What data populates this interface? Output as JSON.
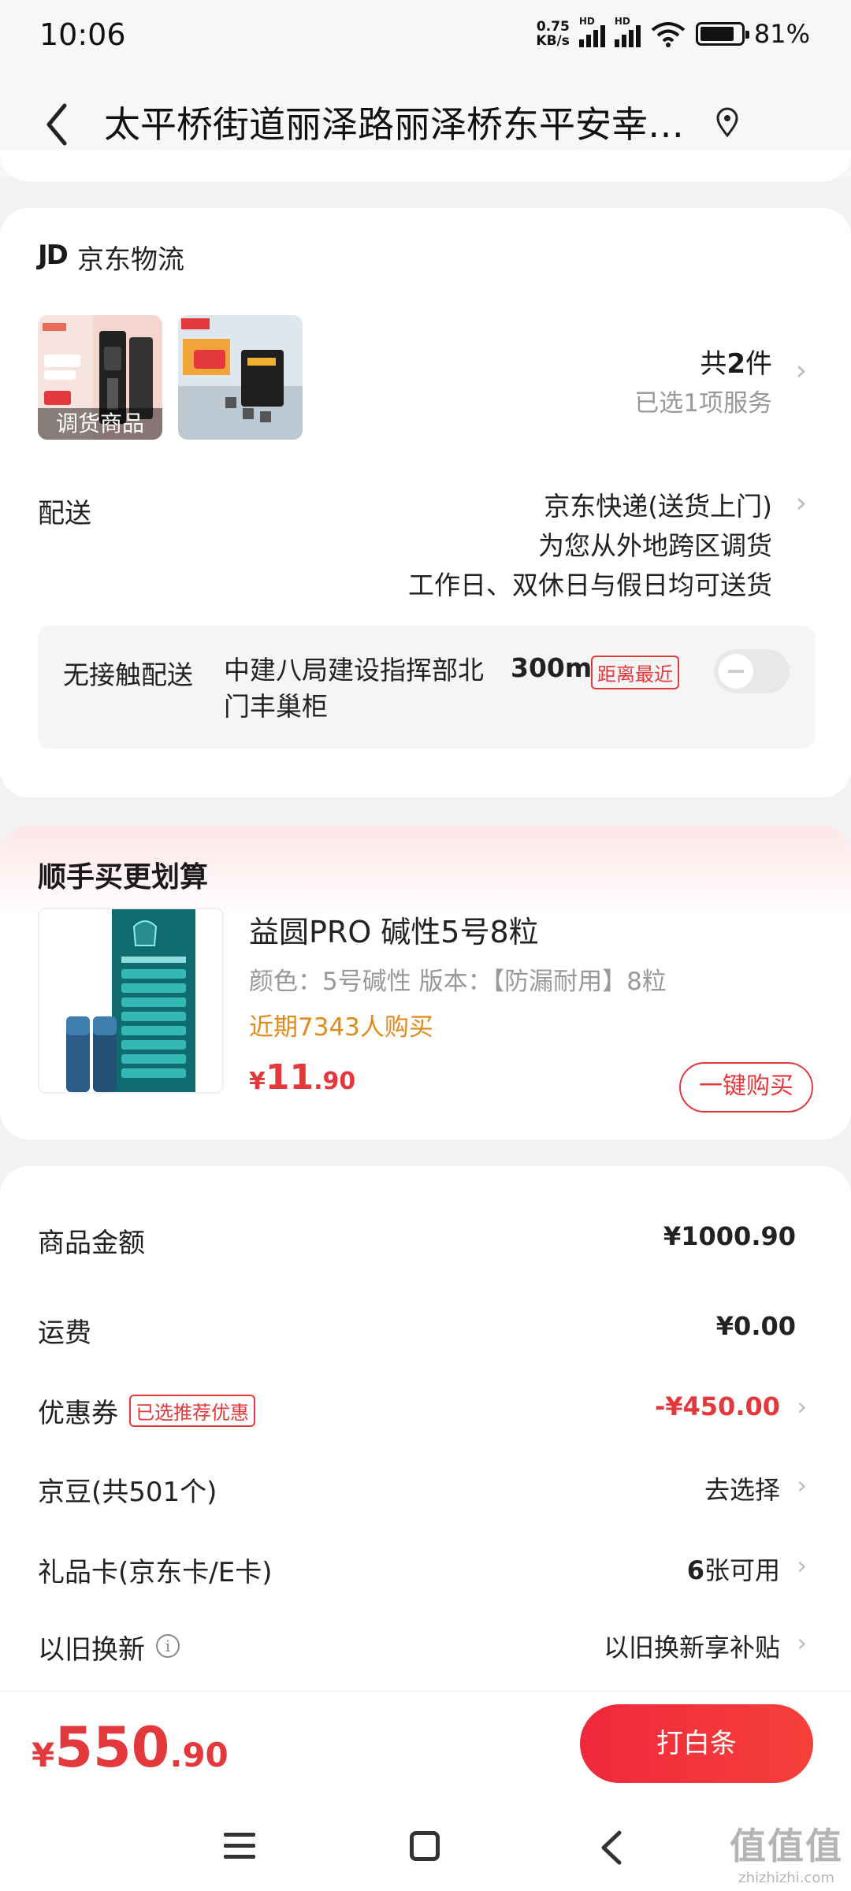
{
  "status_bar": {
    "time": "10:06",
    "speed_value": "0.75",
    "speed_unit": "KB/s",
    "battery": "81%"
  },
  "header": {
    "address": "太平桥街道丽泽路丽泽桥东平安幸…"
  },
  "logistics": {
    "brand_logo": "JD",
    "brand_label": "京东物流",
    "product_tag": "调货商品",
    "count_prefix": "共",
    "count_num": "2",
    "count_suffix": "件",
    "service_selected": "已选1项服务",
    "delivery_label": "配送",
    "delivery_method": "京东快递(送货上门)",
    "delivery_note1": "为您从外地跨区调货",
    "delivery_note2": "工作日、双休日与假日均可送货",
    "contactless_label": "无接触配送",
    "contactless_address": "中建八局建设指挥部北门丰巢柜",
    "contactless_distance": "300m",
    "contactless_tag": "距离最近",
    "contactless_enabled": false
  },
  "upsell": {
    "title": "顺手买更划算",
    "product_name": "益圆PRO  碱性5号8粒",
    "product_spec": "颜色：5号碱性   版本：【防漏耐用】8粒",
    "buyers": "近期7343人购买",
    "price_currency": "¥",
    "price_int": "11",
    "price_dec": ".90",
    "buy_button": "一键购买"
  },
  "price_detail": {
    "rows": [
      {
        "label": "商品金额",
        "value": "¥1000.90"
      },
      {
        "label": "运费",
        "value": "¥0.00"
      },
      {
        "label": "优惠券",
        "tag": "已选推荐优惠",
        "value": "-¥450.00"
      },
      {
        "label": "京豆(共501个)",
        "value": "去选择"
      },
      {
        "label": "礼品卡(京东卡/E卡)",
        "value_num": "6",
        "value": "张可用"
      },
      {
        "label": "以旧换新",
        "value": "以旧换新享补贴"
      }
    ]
  },
  "bottom": {
    "total_currency": "¥",
    "total_int": "550",
    "total_dec": ".90",
    "pay_button": "打白条"
  },
  "watermark": {
    "line1": "值值值",
    "line2": "zhizhizhi.com"
  },
  "colors": {
    "accent": "#e4393c",
    "orange": "#e08a1a"
  }
}
